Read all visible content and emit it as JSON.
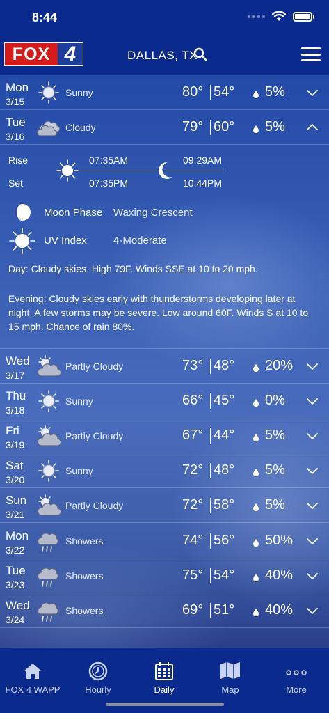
{
  "status": {
    "time": "8:44"
  },
  "header": {
    "logo_fox": "FOX",
    "logo_num": "4",
    "city": "DALLAS, TX"
  },
  "rows": [
    {
      "day": "Mon",
      "date": "3/15",
      "icon": "sun-icon",
      "condition": "Sunny",
      "high": "80°",
      "low": "54°",
      "precip": "5%",
      "expanded": false
    },
    {
      "day": "Tue",
      "date": "3/16",
      "icon": "cloud-icon",
      "condition": "Cloudy",
      "high": "79°",
      "low": "60°",
      "precip": "5%",
      "expanded": true
    },
    {
      "day": "Wed",
      "date": "3/17",
      "icon": "partly-cloudy-icon",
      "condition": "Partly Cloudy",
      "high": "73°",
      "low": "48°",
      "precip": "20%",
      "expanded": false
    },
    {
      "day": "Thu",
      "date": "3/18",
      "icon": "sun-icon",
      "condition": "Sunny",
      "high": "66°",
      "low": "45°",
      "precip": "0%",
      "expanded": false
    },
    {
      "day": "Fri",
      "date": "3/19",
      "icon": "partly-cloudy-icon",
      "condition": "Partly Cloudy",
      "high": "67°",
      "low": "44°",
      "precip": "5%",
      "expanded": false
    },
    {
      "day": "Sat",
      "date": "3/20",
      "icon": "sun-icon",
      "condition": "Sunny",
      "high": "72°",
      "low": "48°",
      "precip": "5%",
      "expanded": false
    },
    {
      "day": "Sun",
      "date": "3/21",
      "icon": "partly-cloudy-icon",
      "condition": "Partly Cloudy",
      "high": "72°",
      "low": "58°",
      "precip": "5%",
      "expanded": false
    },
    {
      "day": "Mon",
      "date": "3/22",
      "icon": "showers-icon",
      "condition": "Showers",
      "high": "74°",
      "low": "56°",
      "precip": "50%",
      "expanded": false
    },
    {
      "day": "Tue",
      "date": "3/23",
      "icon": "showers-icon",
      "condition": "Showers",
      "high": "75°",
      "low": "54°",
      "precip": "40%",
      "expanded": false
    },
    {
      "day": "Wed",
      "date": "3/24",
      "icon": "showers-icon",
      "condition": "Showers",
      "high": "69°",
      "low": "51°",
      "precip": "40%",
      "expanded": false
    }
  ],
  "details": {
    "rise_label": "Rise",
    "set_label": "Set",
    "sunrise": "07:35AM",
    "sunset": "07:35PM",
    "moonrise": "09:29AM",
    "moonset": "10:44PM",
    "moon_phase_label": "Moon Phase",
    "moon_phase_value": "Waxing Crescent",
    "uv_label": "UV Index",
    "uv_value": "4-Moderate",
    "day_label": "Day",
    "day_text": ": Cloudy skies. High 79F. Winds SSE at 10 to 20 mph.",
    "evening_label": "Evening",
    "evening_text": ": Cloudy skies early with thunderstorms developing later at night. A few storms may be severe. Low around 60F. Winds S at 10 to 15 mph. Chance of rain 80%."
  },
  "tabs": [
    {
      "label": "FOX 4 WAPP",
      "icon": "home-icon",
      "active": false
    },
    {
      "label": "Hourly",
      "icon": "clock-icon",
      "active": false
    },
    {
      "label": "Daily",
      "icon": "calendar-icon",
      "active": true
    },
    {
      "label": "Map",
      "icon": "map-icon",
      "active": false
    },
    {
      "label": "More",
      "icon": "more-dots-icon",
      "active": false
    }
  ]
}
